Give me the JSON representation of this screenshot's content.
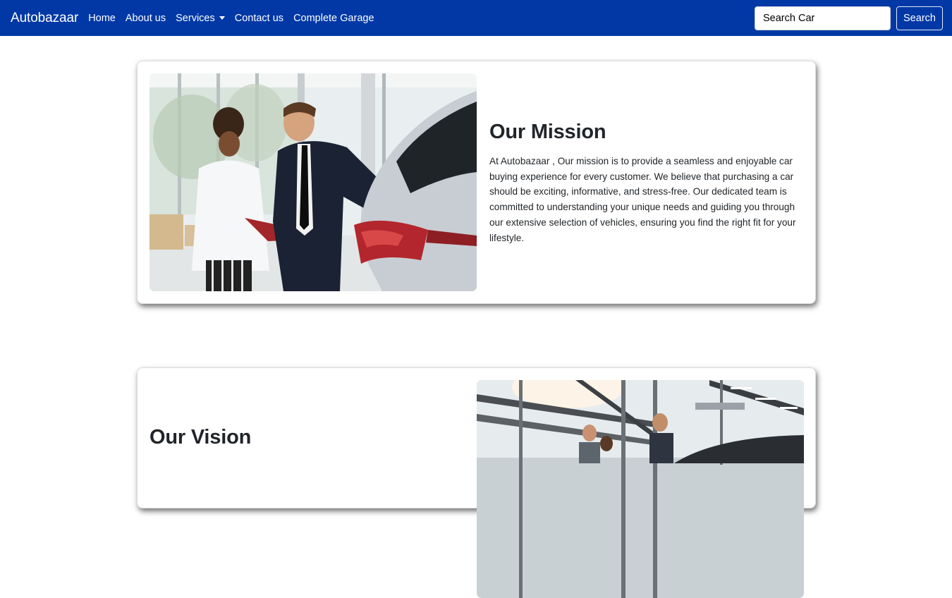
{
  "navbar": {
    "brand": "Autobazaar",
    "links": [
      "Home",
      "About us",
      "Services",
      "Contact us",
      "Complete Garage"
    ],
    "search_placeholder": "Search Car",
    "search_button": "Search",
    "background": "#0138a6"
  },
  "mission": {
    "title": "Our Mission",
    "text": "At Autobazaar , Our mission is to provide a seamless and enjoyable car buying experience for every customer. We believe that purchasing a car should be exciting, informative, and stress-free. Our dedicated team is committed to understanding your unique needs and guiding you through our extensive selection of vehicles, ensuring you find the right fit for your lifestyle."
  },
  "vision": {
    "title": "Our Vision"
  }
}
